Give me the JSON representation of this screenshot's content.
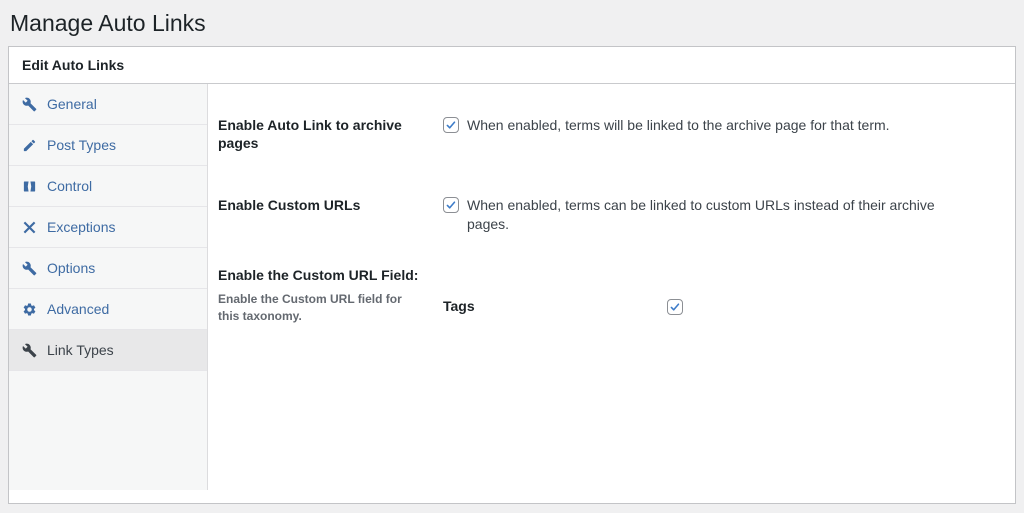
{
  "page": {
    "title": "Manage Auto Links"
  },
  "panel": {
    "header": "Edit Auto Links"
  },
  "sidebar": {
    "items": [
      {
        "label": "General",
        "icon": "wrench-icon",
        "active": false
      },
      {
        "label": "Post Types",
        "icon": "edit-icon",
        "active": false
      },
      {
        "label": "Control",
        "icon": "controls-icon",
        "active": false
      },
      {
        "label": "Exceptions",
        "icon": "shuffle-icon",
        "active": false
      },
      {
        "label": "Options",
        "icon": "wrench-icon",
        "active": false
      },
      {
        "label": "Advanced",
        "icon": "gear-icon",
        "active": false
      },
      {
        "label": "Link Types",
        "icon": "wrench-icon",
        "active": true
      }
    ]
  },
  "settings": {
    "rows": [
      {
        "label": "Enable Auto Link to archive pages",
        "checked": true,
        "description": "When enabled, terms will be linked to the archive page for that term."
      },
      {
        "label": "Enable Custom URLs",
        "checked": true,
        "description": "When enabled, terms can be linked to custom URLs instead of their archive pages."
      },
      {
        "label": "Enable the Custom URL Field:",
        "sublabel": "Enable the Custom URL field for this taxonomy.",
        "taxonomy": "Tags",
        "checked": true
      }
    ]
  },
  "colors": {
    "page_bg": "#f0f0f1",
    "panel_border": "#c3c4c7",
    "sidebar_bg": "#f6f7f7",
    "link_blue": "#3e6ba3",
    "active_tab_bg": "#e8e8e9",
    "active_tab_text": "#3c434a",
    "check_blue": "#3d7cc9",
    "heading_text": "#1d2327",
    "muted_text": "#646970"
  }
}
